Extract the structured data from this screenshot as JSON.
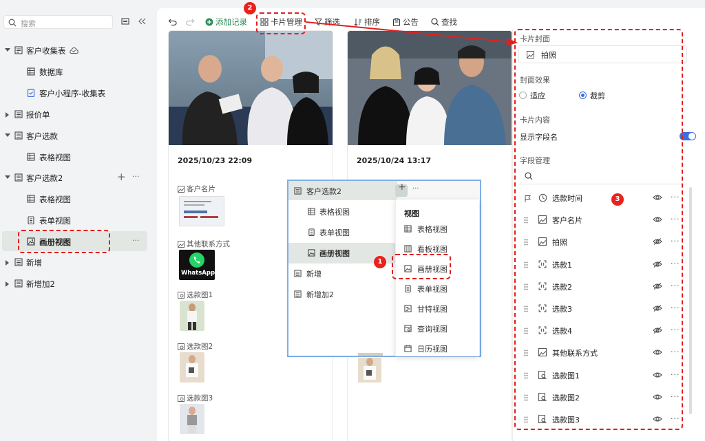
{
  "sidebar": {
    "search_placeholder": "搜索",
    "items": [
      {
        "label": "客户收集表"
      },
      {
        "label": "数据库"
      },
      {
        "label": "客户小程序-收集表"
      },
      {
        "label": "报价单"
      },
      {
        "label": "客户选款"
      },
      {
        "label": "表格视图"
      },
      {
        "label": "客户选款2"
      },
      {
        "label": "表格视图"
      },
      {
        "label": "表单视图"
      },
      {
        "label": "画册视图"
      },
      {
        "label": "新增"
      },
      {
        "label": "新增加2"
      }
    ],
    "more": "···",
    "plus": "+"
  },
  "toolbar": {
    "add": "添加记录",
    "card_manage": "卡片管理",
    "filter": "筛选",
    "sort": "排序",
    "notice": "公告",
    "find": "查找"
  },
  "cards": [
    {
      "date": "2025/10/23 22:09",
      "fields": [
        "客户名片",
        "其他联系方式",
        "选款图1",
        "选款图2",
        "选款图3"
      ],
      "whatsapp_text": "WhatsApp"
    },
    {
      "date": "2025/10/24 13:17"
    }
  ],
  "popup": {
    "rows": [
      {
        "label": "客户选款2"
      },
      {
        "label": "表格视图"
      },
      {
        "label": "表单视图"
      },
      {
        "label": "画册视图"
      },
      {
        "label": "新增"
      },
      {
        "label": "新增加2"
      }
    ],
    "plus": "+",
    "more": "···",
    "submenu_title": "视图",
    "submenu": [
      {
        "label": "表格视图"
      },
      {
        "label": "看板视图"
      },
      {
        "label": "画册视图"
      },
      {
        "label": "表单视图"
      },
      {
        "label": "甘特视图"
      },
      {
        "label": "查询视图"
      },
      {
        "label": "日历视图"
      }
    ]
  },
  "panel": {
    "card_cover": "卡片封面",
    "cover_value": "拍照",
    "cover_effect": "封面效果",
    "fit": "适应",
    "crop": "裁剪",
    "card_content": "卡片内容",
    "show_field_name": "显示字段名",
    "field_manage": "字段管理",
    "fields": [
      {
        "label": "选款时间",
        "visible": true
      },
      {
        "label": "客户名片",
        "visible": true
      },
      {
        "label": "拍照",
        "visible": false
      },
      {
        "label": "选款1",
        "visible": false
      },
      {
        "label": "选款2",
        "visible": false
      },
      {
        "label": "选款3",
        "visible": false
      },
      {
        "label": "选款4",
        "visible": false
      },
      {
        "label": "其他联系方式",
        "visible": true
      },
      {
        "label": "选款图1",
        "visible": true
      },
      {
        "label": "选款图2",
        "visible": true
      },
      {
        "label": "选款图3",
        "visible": true
      }
    ],
    "more": "···"
  },
  "badges": [
    "1",
    "2",
    "3"
  ],
  "colors": {
    "accent_green": "#2e8b57",
    "annotation_red": "#e02020",
    "toggle_blue": "#3b6fe0"
  }
}
